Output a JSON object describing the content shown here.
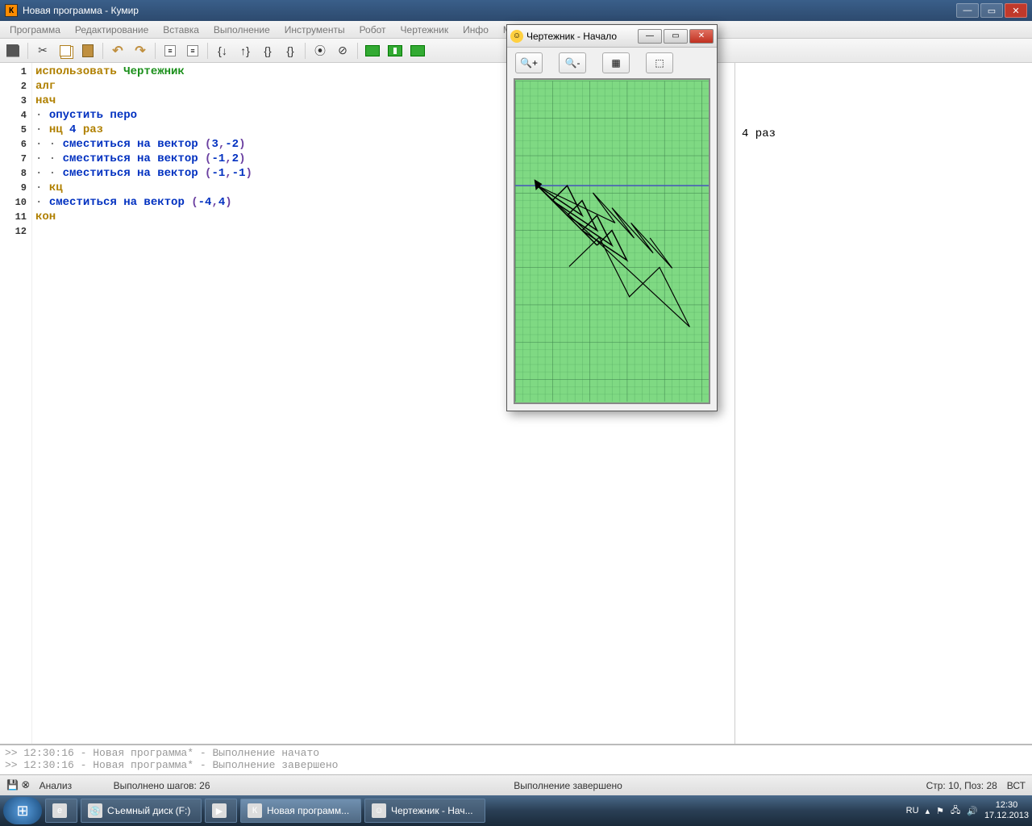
{
  "window": {
    "title": "Новая программа - Кумир",
    "app_icon_letter": "К"
  },
  "menu": [
    "Программа",
    "Редактирование",
    "Вставка",
    "Выполнение",
    "Инструменты",
    "Робот",
    "Чертежник",
    "Инфо",
    "Миры"
  ],
  "code": {
    "lines": [
      {
        "n": 1,
        "tokens": [
          {
            "t": "использовать ",
            "c": "kw"
          },
          {
            "t": "Чертежник",
            "c": "module"
          }
        ]
      },
      {
        "n": 2,
        "tokens": [
          {
            "t": "алг",
            "c": "kw"
          }
        ]
      },
      {
        "n": 3,
        "tokens": [
          {
            "t": "нач",
            "c": "kw"
          }
        ]
      },
      {
        "n": 4,
        "tokens": [
          {
            "t": "· ",
            "c": "dot"
          },
          {
            "t": "опустить перо",
            "c": "cmd"
          }
        ]
      },
      {
        "n": 5,
        "tokens": [
          {
            "t": "· ",
            "c": "dot"
          },
          {
            "t": "нц ",
            "c": "kw"
          },
          {
            "t": "4",
            "c": "num"
          },
          {
            "t": " раз",
            "c": "kw"
          }
        ]
      },
      {
        "n": 6,
        "tokens": [
          {
            "t": "· · ",
            "c": "dot"
          },
          {
            "t": "сместиться на вектор ",
            "c": "cmd"
          },
          {
            "t": "(",
            "c": "paren"
          },
          {
            "t": "3",
            "c": "num"
          },
          {
            "t": ",",
            "c": "paren"
          },
          {
            "t": "-2",
            "c": "num"
          },
          {
            "t": ")",
            "c": "paren"
          }
        ]
      },
      {
        "n": 7,
        "tokens": [
          {
            "t": "· · ",
            "c": "dot"
          },
          {
            "t": "сместиться на вектор ",
            "c": "cmd"
          },
          {
            "t": "(",
            "c": "paren"
          },
          {
            "t": "-1",
            "c": "num"
          },
          {
            "t": ",",
            "c": "paren"
          },
          {
            "t": "2",
            "c": "num"
          },
          {
            "t": ")",
            "c": "paren"
          }
        ]
      },
      {
        "n": 8,
        "tokens": [
          {
            "t": "· · ",
            "c": "dot"
          },
          {
            "t": "сместиться на вектор ",
            "c": "cmd"
          },
          {
            "t": "(",
            "c": "paren"
          },
          {
            "t": "-1",
            "c": "num"
          },
          {
            "t": ",",
            "c": "paren"
          },
          {
            "t": "-1",
            "c": "num"
          },
          {
            "t": ")",
            "c": "paren"
          }
        ]
      },
      {
        "n": 9,
        "tokens": [
          {
            "t": "· ",
            "c": "dot"
          },
          {
            "t": "кц",
            "c": "kw"
          }
        ]
      },
      {
        "n": 10,
        "tokens": [
          {
            "t": "· ",
            "c": "dot"
          },
          {
            "t": "сместиться на вектор ",
            "c": "cmd"
          },
          {
            "t": "(",
            "c": "paren"
          },
          {
            "t": "-4",
            "c": "num"
          },
          {
            "t": ",",
            "c": "paren"
          },
          {
            "t": "4",
            "c": "num"
          },
          {
            "t": ")",
            "c": "paren"
          }
        ]
      },
      {
        "n": 11,
        "tokens": [
          {
            "t": "кон",
            "c": "kw"
          }
        ]
      },
      {
        "n": 12,
        "tokens": []
      }
    ]
  },
  "side_text": "4 раз",
  "console": [
    ">> 12:30:16 - Новая программа* - Выполнение начато",
    ">> 12:30:16 - Новая программа* - Выполнение завершено"
  ],
  "status": {
    "analysis": "Анализ",
    "steps": "Выполнено шагов: 26",
    "done": "Выполнение завершено",
    "pos": "Стр: 10, Поз: 28",
    "ins": "ВСТ"
  },
  "child": {
    "title": "Чертежник - Начало"
  },
  "taskbar": {
    "items": [
      {
        "label": "",
        "icon": "e"
      },
      {
        "label": "Съемный диск (F:)",
        "icon": "💿",
        "wide": true
      },
      {
        "label": "",
        "icon": "▶"
      },
      {
        "label": "Новая программ...",
        "icon": "К",
        "active": true,
        "wide": true
      },
      {
        "label": "Чертежник - Нач...",
        "icon": "☺",
        "wide": true
      }
    ],
    "lang": "RU",
    "time": "12:30",
    "date": "17.12.2013"
  }
}
